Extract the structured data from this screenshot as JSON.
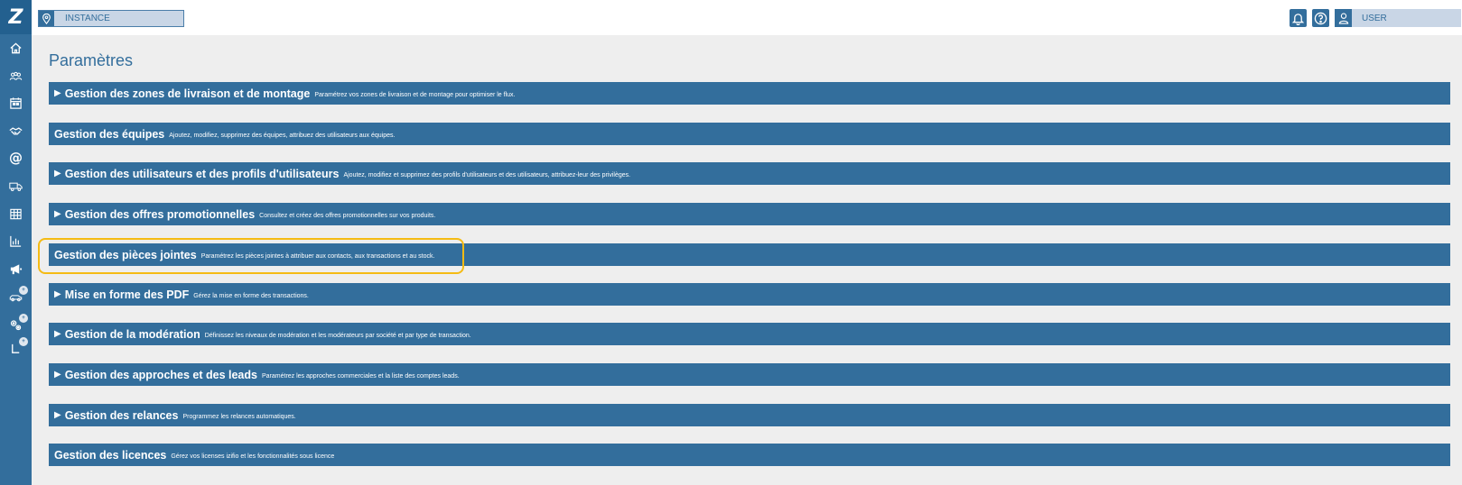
{
  "app": {
    "logo_letter": "Z"
  },
  "topbar": {
    "instance_label": "INSTANCE",
    "user_label": "USER"
  },
  "sidebar": {
    "items": [
      {
        "icon": "home-icon"
      },
      {
        "icon": "users-group-icon"
      },
      {
        "icon": "calendar-icon"
      },
      {
        "icon": "handshake-icon"
      },
      {
        "icon": "at-sign-icon",
        "glyph": "@"
      },
      {
        "icon": "truck-icon"
      },
      {
        "icon": "table-icon"
      },
      {
        "icon": "bar-chart-icon"
      },
      {
        "icon": "megaphone-icon"
      },
      {
        "icon": "car-icon",
        "badge": "+"
      },
      {
        "icon": "settings-gears-icon",
        "badge": "+"
      },
      {
        "icon": "corner-icon",
        "badge": "+"
      }
    ]
  },
  "main": {
    "title": "Paramètres",
    "sections": [
      {
        "arrow": "▶",
        "title": "Gestion des zones de livraison et de montage",
        "desc": "Paramétrez vos zones de livraison et de montage pour optimiser le flux."
      },
      {
        "arrow": "",
        "title": "Gestion des équipes",
        "desc": "Ajoutez, modifiez, supprimez des équipes, attribuez des utilisateurs aux équipes."
      },
      {
        "arrow": "▶",
        "title": "Gestion des utilisateurs et des profils d'utilisateurs",
        "desc": "Ajoutez, modifiez et supprimez des profils d'utilisateurs et des utilisateurs, attribuez-leur des privilèges."
      },
      {
        "arrow": "▶",
        "title": "Gestion des offres promotionnelles",
        "desc": "Consultez et créez des offres promotionnelles sur vos produits."
      },
      {
        "arrow": "",
        "title": "Gestion des pièces jointes",
        "desc": "Paramétrez les pièces jointes à attribuer aux contacts, aux transactions et au stock."
      },
      {
        "arrow": "▶",
        "title": "Mise en forme des PDF",
        "desc": "Gérez la mise en forme des transactions."
      },
      {
        "arrow": "▶",
        "title": "Gestion de la modération",
        "desc": "Définissez les niveaux de modération et les modérateurs par société et par type de transaction."
      },
      {
        "arrow": "▶",
        "title": "Gestion des approches et des leads",
        "desc": "Paramétrez les approches commerciales et la liste des comptes leads."
      },
      {
        "arrow": "▶",
        "title": "Gestion des relances",
        "desc": "Programmez les relances automatiques."
      },
      {
        "arrow": "",
        "title": "Gestion des licences",
        "desc": "Gérez vos licenses izifio et les fonctionnalités sous licence"
      }
    ]
  },
  "colors": {
    "primary": "#336e9c",
    "highlight": "#f5bb14",
    "background": "#eeeeee"
  }
}
